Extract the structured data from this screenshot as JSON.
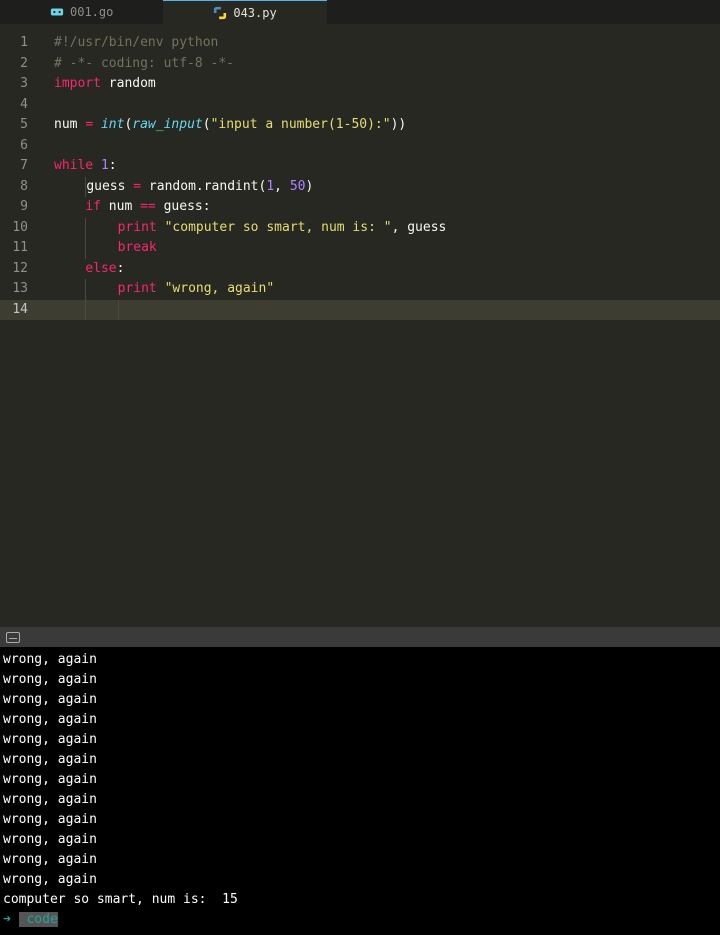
{
  "tabs": [
    {
      "label": "001.go",
      "icon": "go-icon",
      "active": false
    },
    {
      "label": "043.py",
      "icon": "python-icon",
      "active": true
    }
  ],
  "code": {
    "lines": [
      {
        "n": 1,
        "tokens": [
          [
            "comment",
            "#!/usr/bin/env python"
          ]
        ]
      },
      {
        "n": 2,
        "tokens": [
          [
            "comment",
            "# -*- coding: utf-8 -*-"
          ]
        ]
      },
      {
        "n": 3,
        "tokens": [
          [
            "keyword",
            "import"
          ],
          [
            "ident",
            " random"
          ]
        ]
      },
      {
        "n": 4,
        "tokens": []
      },
      {
        "n": 5,
        "tokens": [
          [
            "ident",
            "num "
          ],
          [
            "op",
            "="
          ],
          [
            "ident",
            " "
          ],
          [
            "builtin",
            "int"
          ],
          [
            "ident",
            "("
          ],
          [
            "builtin",
            "raw_input"
          ],
          [
            "ident",
            "("
          ],
          [
            "string",
            "\"input a number(1-50):\""
          ],
          [
            "ident",
            "))"
          ]
        ]
      },
      {
        "n": 6,
        "tokens": []
      },
      {
        "n": 7,
        "tokens": [
          [
            "keyword",
            "while"
          ],
          [
            "ident",
            " "
          ],
          [
            "number",
            "1"
          ],
          [
            "ident",
            ":"
          ]
        ]
      },
      {
        "n": 8,
        "indent": 1,
        "tokens": [
          [
            "ident",
            "    guess "
          ],
          [
            "op",
            "="
          ],
          [
            "ident",
            " random.randint("
          ],
          [
            "number",
            "1"
          ],
          [
            "ident",
            ", "
          ],
          [
            "number",
            "50"
          ],
          [
            "ident",
            ")"
          ]
        ]
      },
      {
        "n": 9,
        "indent": 1,
        "tokens": [
          [
            "ident",
            "    "
          ],
          [
            "keyword",
            "if"
          ],
          [
            "ident",
            " num "
          ],
          [
            "op",
            "=="
          ],
          [
            "ident",
            " guess:"
          ]
        ]
      },
      {
        "n": 10,
        "indent": 2,
        "tokens": [
          [
            "ident",
            "        "
          ],
          [
            "keyword",
            "print"
          ],
          [
            "ident",
            " "
          ],
          [
            "string",
            "\"computer so smart, num is: \""
          ],
          [
            "ident",
            ", guess"
          ]
        ]
      },
      {
        "n": 11,
        "indent": 2,
        "tokens": [
          [
            "ident",
            "        "
          ],
          [
            "keyword",
            "break"
          ]
        ]
      },
      {
        "n": 12,
        "indent": 1,
        "tokens": [
          [
            "ident",
            "    "
          ],
          [
            "keyword",
            "else"
          ],
          [
            "ident",
            ":"
          ]
        ]
      },
      {
        "n": 13,
        "indent": 2,
        "tokens": [
          [
            "ident",
            "        "
          ],
          [
            "keyword",
            "print"
          ],
          [
            "ident",
            " "
          ],
          [
            "string",
            "\"wrong, again\""
          ]
        ]
      },
      {
        "n": 14,
        "indent": 2,
        "tokens": [],
        "current": true
      }
    ]
  },
  "terminal": {
    "lines": [
      "wrong, again",
      "wrong, again",
      "wrong, again",
      "wrong, again",
      "wrong, again",
      "wrong, again",
      "wrong, again",
      "wrong, again",
      "wrong, again",
      "wrong, again",
      "wrong, again",
      "wrong, again",
      "computer so smart, num is:  15"
    ],
    "prompt_arrow": "➜",
    "prompt_text": " code"
  }
}
